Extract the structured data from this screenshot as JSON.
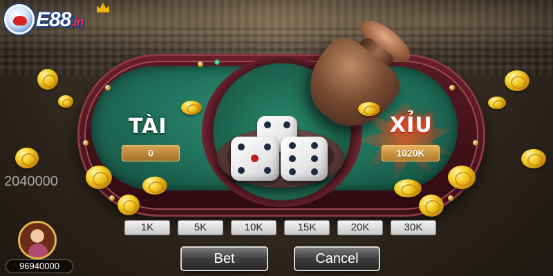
{
  "logo": {
    "text": "E88",
    "suffix": ".in"
  },
  "table": {
    "tai": {
      "label": "TÀI",
      "amount": "0"
    },
    "xiu": {
      "label": "XỈU",
      "amount": "1020K",
      "highlighted": true
    }
  },
  "dice": [
    {
      "face": 4
    },
    {
      "face": 5
    },
    {
      "face": 6
    }
  ],
  "player": {
    "pot_total": "2040000",
    "balance": "96940000",
    "avatar_icon": "female-player-avatar-icon"
  },
  "chips": [
    "1K",
    "5K",
    "10K",
    "15K",
    "20K",
    "30K"
  ],
  "actions": {
    "bet_label": "Bet",
    "cancel_label": "Cancel"
  },
  "colors": {
    "felt": "#1f6e58",
    "rail": "#5a1a24",
    "amount_box": "#c28c3e",
    "xiu_glow": "#ff3c1e"
  }
}
